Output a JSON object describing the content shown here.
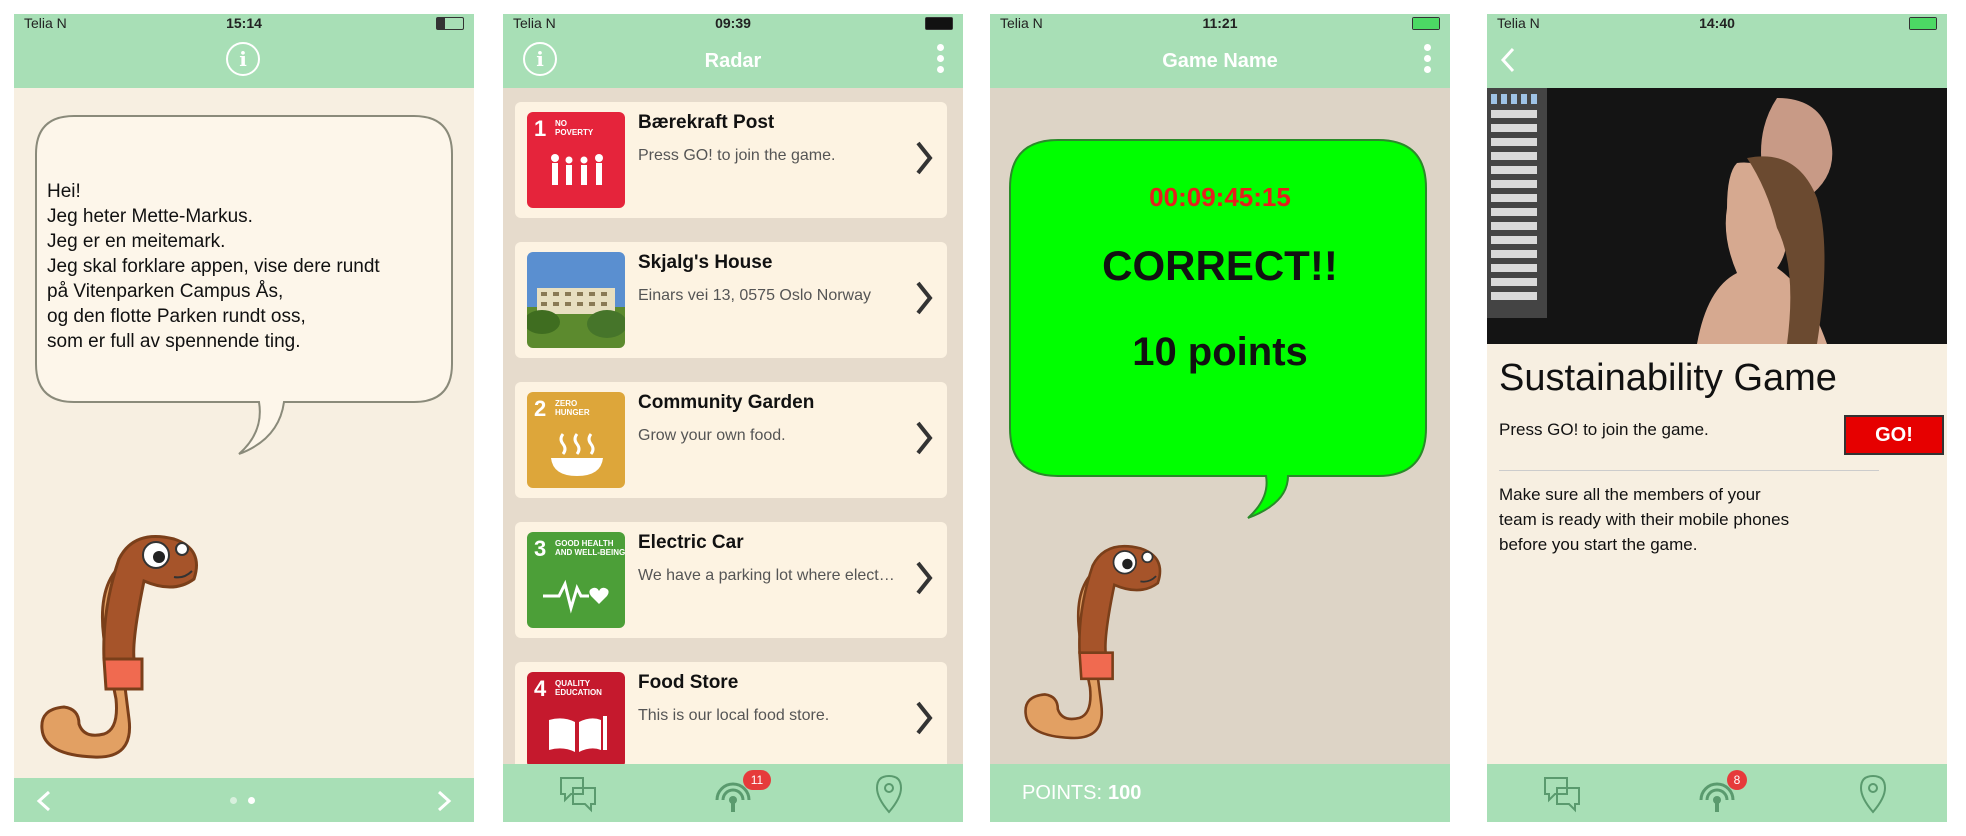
{
  "screens": [
    {
      "status": {
        "carrier": "Telia N",
        "time": "15:14"
      },
      "bubble_text": "Hei!\nJeg heter Mette-Markus.\nJeg er en meitemark.\nJeg skal forklare appen, vise dere rundt\npå Vitenparken Campus Ås,\nog den flotte Parken rundt oss,\nsom er full av spennende ting.",
      "page_index": 2,
      "page_count": 2
    },
    {
      "status": {
        "carrier": "Telia N",
        "time": "09:39"
      },
      "title": "Radar",
      "items": [
        {
          "title": "Bærekraft Post",
          "subtitle": "Press GO! to join the game.",
          "sdg_number": "1",
          "sdg_label": "NO\nPOVERTY",
          "color": "#e5243b"
        },
        {
          "title": "Skjalg's House",
          "subtitle": "Einars vei 13, 0575 Oslo Norway",
          "photo": true
        },
        {
          "title": "Community Garden",
          "subtitle": "Grow your own food.",
          "sdg_number": "2",
          "sdg_label": "ZERO\nHUNGER",
          "color": "#dda63a"
        },
        {
          "title": "Electric Car",
          "subtitle": "We have a parking lot where electric cars can charge.",
          "sdg_number": "3",
          "sdg_label": "GOOD HEALTH\nAND WELL-BEING",
          "color": "#4c9f38"
        },
        {
          "title": "Food Store",
          "subtitle": "This is our local food store.",
          "sdg_number": "4",
          "sdg_label": "QUALITY\nEDUCATION",
          "color": "#c5192d"
        }
      ],
      "radar_badge": "11"
    },
    {
      "status": {
        "carrier": "Telia N",
        "time": "11:21"
      },
      "title": "Game Name",
      "timer": "00:09:45:15",
      "result": "CORRECT!!",
      "points_text": "10 points",
      "points_label": "POINTS:",
      "points_value": "100",
      "colors": {
        "bubble": "#00ff00",
        "timer": "#e61e1e"
      }
    },
    {
      "status": {
        "carrier": "Telia N",
        "time": "14:40"
      },
      "title": "Sustainability Game",
      "subtitle": "Press GO! to join the game.",
      "go_label": "GO!",
      "description": "Make sure all the members of your\nteam is ready with their mobile phones\nbefore you start the game.",
      "radar_badge": "8"
    }
  ],
  "colors": {
    "bar": "#a8dfb6",
    "cream": "#f7efe1"
  }
}
